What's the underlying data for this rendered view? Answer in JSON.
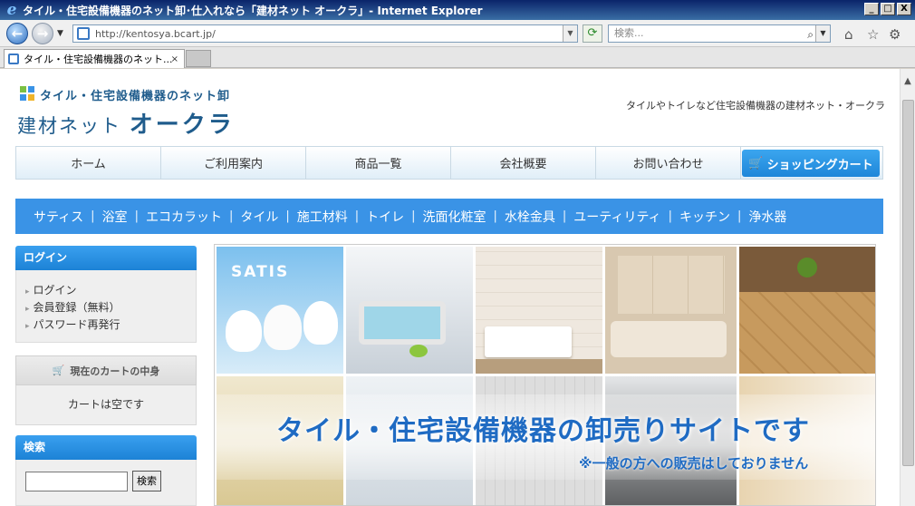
{
  "window": {
    "title": "タイル・住宅設備機器のネット卸･仕入れなら「建材ネット オークラ」- Internet Explorer",
    "buttons": {
      "minimize": "_",
      "maximize": "□",
      "close": "X"
    }
  },
  "address_bar": {
    "url": "http://kentosya.bcart.jp/",
    "search_placeholder": "検索..."
  },
  "tab": {
    "label": "タイル・住宅設備機器のネット...",
    "close": "×"
  },
  "site": {
    "logo_sub": "タイル・住宅設備機器のネット卸",
    "logo_main_prefix": "建材ネット ",
    "logo_main_name": "オークラ",
    "tagline": "タイルやトイレなど住宅設備機器の建材ネット・オークラ",
    "colors": {
      "accent": "#3a93e6",
      "brand": "#1f5c8c"
    }
  },
  "main_nav": {
    "items": [
      "ホーム",
      "ご利用案内",
      "商品一覧",
      "会社概要",
      "お問い合わせ"
    ],
    "cart_button": "ショッピングカート"
  },
  "categories": [
    "サティス",
    "浴室",
    "エコカラット",
    "タイル",
    "施工材料",
    "トイレ",
    "洗面化粧室",
    "水栓金具",
    "ユーティリティ",
    "キッチン",
    "浄水器"
  ],
  "sidebar": {
    "login": {
      "title": "ログイン",
      "links": [
        "ログイン",
        "会員登録（無料）",
        "パスワード再発行"
      ]
    },
    "cart": {
      "title": "現在のカートの中身",
      "empty_text": "カートは空です"
    },
    "search": {
      "title": "検索",
      "button": "検索",
      "value": ""
    }
  },
  "hero": {
    "satis_label": "SATIS",
    "title_part1": "タイル・住宅設備機器",
    "title_part2": "の卸売りサイトです",
    "note": "※一般の方への販売はしておりません"
  }
}
